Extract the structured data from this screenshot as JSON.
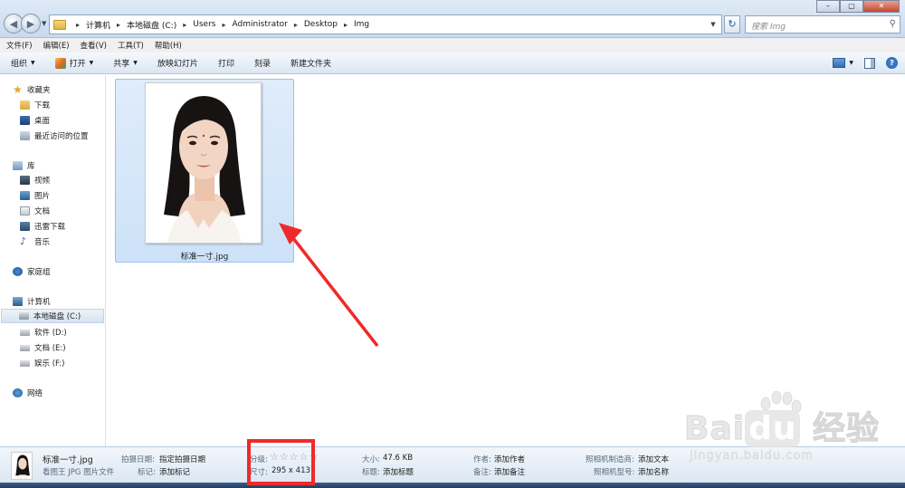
{
  "address_bar": {
    "breadcrumbs": [
      "计算机",
      "本地磁盘 (C:)",
      "Users",
      "Administrator",
      "Desktop",
      "Img"
    ],
    "search_placeholder": "搜索 Img"
  },
  "menu": [
    "文件(F)",
    "编辑(E)",
    "查看(V)",
    "工具(T)",
    "帮助(H)"
  ],
  "toolbar": {
    "organize": "组织",
    "open": "打开",
    "share": "共享",
    "slideshow": "放映幻灯片",
    "print": "打印",
    "burn": "刻录",
    "new_folder": "新建文件夹"
  },
  "nav": {
    "favorites": "收藏夹",
    "fav_items": [
      "下载",
      "桌面",
      "最近访问的位置"
    ],
    "libraries": "库",
    "lib_items": [
      "视频",
      "图片",
      "文档",
      "迅雷下载",
      "音乐"
    ],
    "homegroup": "家庭组",
    "computer": "计算机",
    "drives": [
      "本地磁盘 (C:)",
      "软件 (D:)",
      "文档 (E:)",
      "娱乐 (F:)"
    ],
    "network": "网络"
  },
  "file": {
    "name": "标准一寸.jpg"
  },
  "details": {
    "name": "标准一寸.jpg",
    "type": "看图王 JPG 图片文件",
    "date_taken_label": "拍摄日期:",
    "date_taken_value": "指定拍摄日期",
    "tags_label": "标记:",
    "tags_value": "添加标记",
    "rating_label": "分级:",
    "rating_stars": "☆☆☆☆☆",
    "rating": 0,
    "dimensions_label": "尺寸:",
    "dimensions_value": "295 x 413",
    "size_label": "大小:",
    "size_value": "47.6 KB",
    "title_label": "标题:",
    "title_value": "添加标题",
    "author_label": "作者:",
    "author_value": "添加作者",
    "comments_label": "备注:",
    "comments_value": "添加备注",
    "maker_label": "照相机制造商:",
    "maker_value": "添加文本",
    "model_label": "照相机型号:",
    "model_value": "添加名称"
  },
  "watermark": {
    "logo": "Bai du 经验",
    "url": "jingyan.baidu.com"
  },
  "colors": {
    "accent": "#cde2f8",
    "annotation_red": "#ef2a2a"
  }
}
